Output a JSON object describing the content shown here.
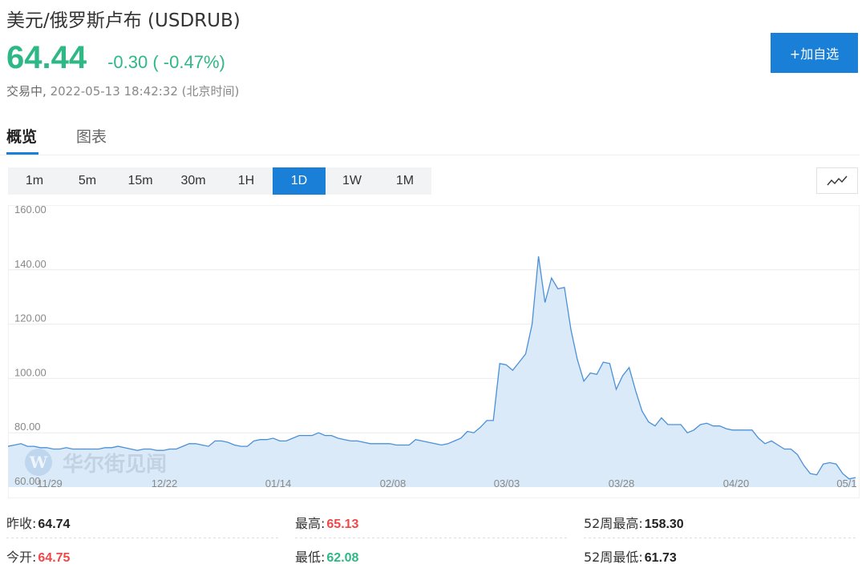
{
  "header": {
    "title": "美元/俄罗斯卢布 (USDRUB)",
    "price": "64.44",
    "change": "-0.30 ( -0.47%)",
    "status": "交易中,",
    "timestamp": "2022-05-13 18:42:32 (北京时间)",
    "add_button": "+加自选"
  },
  "tabs": [
    {
      "label": "概览",
      "active": true
    },
    {
      "label": "图表",
      "active": false
    }
  ],
  "periods": [
    "1m",
    "5m",
    "15m",
    "30m",
    "1H",
    "1D",
    "1W",
    "1M"
  ],
  "active_period": "1D",
  "chart_icon": "line-chart-icon",
  "watermark": "华尔街见闻",
  "stats": {
    "prev_close_label": "昨收:",
    "prev_close": "64.74",
    "open_label": "今开:",
    "open": "64.75",
    "high_label": "最高:",
    "high": "65.13",
    "low_label": "最低:",
    "low": "62.08",
    "high52_label": "52周最高:",
    "high52": "158.30",
    "low52_label": "52周最低:",
    "low52": "61.73"
  },
  "colors": {
    "accent": "#1a7fd6",
    "up": "#f04848",
    "down": "#2eb886",
    "line": "#4a90d9",
    "fill": "#dbeaf8"
  },
  "chart_data": {
    "type": "area",
    "ylim": [
      60,
      160
    ],
    "yticks": [
      "160.00",
      "140.00",
      "120.00",
      "100.00",
      "80.00",
      "60.00"
    ],
    "xticks": [
      "11/29",
      "12/22",
      "01/14",
      "02/08",
      "03/03",
      "03/28",
      "04/20",
      "05/1"
    ],
    "values": [
      75,
      75.5,
      76,
      75,
      75,
      74.5,
      74.5,
      74,
      74,
      74.5,
      74,
      74,
      74,
      74,
      74,
      74.5,
      74.5,
      75,
      74.5,
      74,
      73.5,
      74,
      74,
      73.5,
      73.5,
      74,
      74,
      75,
      76,
      76,
      75.5,
      75,
      77,
      77,
      76.5,
      75.5,
      75,
      75,
      77,
      77.5,
      77.5,
      78,
      77,
      77,
      78,
      79,
      79,
      79,
      80,
      79,
      79,
      78,
      77.5,
      77,
      77,
      76.5,
      76,
      76,
      76,
      76,
      75.5,
      75.5,
      75.5,
      77.5,
      77,
      76.5,
      76,
      75.5,
      76,
      77,
      78,
      80.5,
      80,
      82,
      84.5,
      84.5,
      105.5,
      105,
      103,
      106,
      109,
      120,
      145,
      128,
      137,
      133,
      133.5,
      118,
      107,
      99,
      102,
      101.5,
      106,
      105.5,
      96,
      101,
      104,
      95.5,
      88,
      84,
      82.5,
      85.5,
      83,
      83,
      83,
      80,
      81,
      83,
      83.5,
      82.5,
      82.5,
      81.5,
      81,
      81,
      81,
      81,
      78,
      76,
      77,
      75.5,
      74,
      74,
      72,
      68,
      65,
      64.5,
      68.5,
      69,
      68.5,
      65,
      63,
      63.5
    ]
  }
}
